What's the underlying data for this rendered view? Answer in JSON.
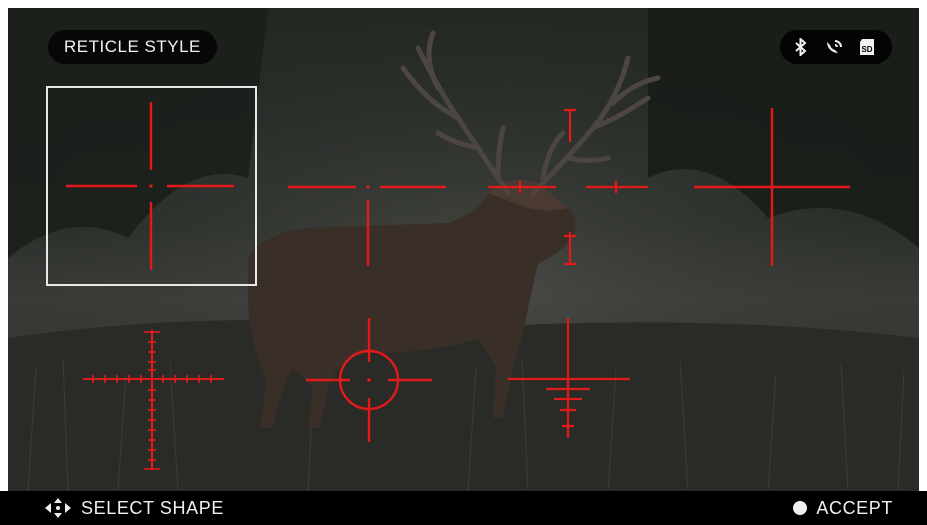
{
  "header": {
    "title": "RETICLE STYLE",
    "status_icons": [
      "bluetooth-icon",
      "wifi-satellite-icon",
      "sd-card-icon"
    ]
  },
  "reticles": {
    "selected_index": 0,
    "items": [
      {
        "style": "simple-crosshair-center-dot"
      },
      {
        "style": "duplex-broken-crosshair"
      },
      {
        "style": "tick-bracket-crosshair"
      },
      {
        "style": "plain-crosshair"
      },
      {
        "style": "mil-dot-hash-crosshair"
      },
      {
        "style": "circle-dot-crosshair"
      },
      {
        "style": "holdover-bdc-crosshair"
      }
    ]
  },
  "footer": {
    "left_icon": "four-way-arrow-icon",
    "left_label": "SELECT SHAPE",
    "right_icon": "accept-dot-icon",
    "right_label": "ACCEPT"
  },
  "colors": {
    "reticle": "#e21a1a",
    "selection": "#e8e8e8",
    "text": "#f2f2f2"
  }
}
